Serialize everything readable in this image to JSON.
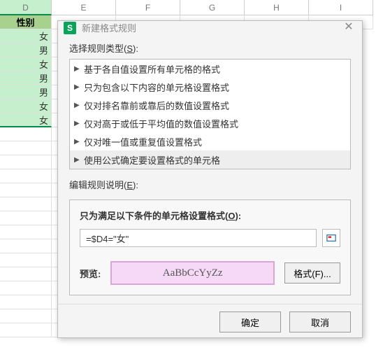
{
  "sheet": {
    "columns": [
      "D",
      "E",
      "F",
      "G",
      "H",
      "I"
    ],
    "header_cell": "性别",
    "rows": [
      "女",
      "男",
      "女",
      "男",
      "男",
      "女",
      "女"
    ]
  },
  "dialog": {
    "title": "新建格式规则",
    "select_type_label": "选择规则类型(",
    "select_type_key": "S",
    "select_type_suffix": "):",
    "rule_types": [
      "基于各自值设置所有单元格的格式",
      "只为包含以下内容的单元格设置格式",
      "仅对排名靠前或靠后的数值设置格式",
      "仅对高于或低于平均值的数值设置格式",
      "仅对唯一值或重复值设置格式",
      "使用公式确定要设置格式的单元格"
    ],
    "selected_rule_index": 5,
    "edit_desc_label": "编辑规则说明(",
    "edit_desc_key": "E",
    "edit_desc_suffix": "):",
    "formula_section_title": "只为满足以下条件的单元格设置格式(",
    "formula_section_key": "O",
    "formula_section_suffix": "):",
    "formula_value": "=$D4=\"女\"",
    "preview_label": "预览:",
    "preview_sample": "AaBbCcYyZz",
    "format_btn": "格式(F)...",
    "ok": "确定",
    "cancel": "取消"
  }
}
